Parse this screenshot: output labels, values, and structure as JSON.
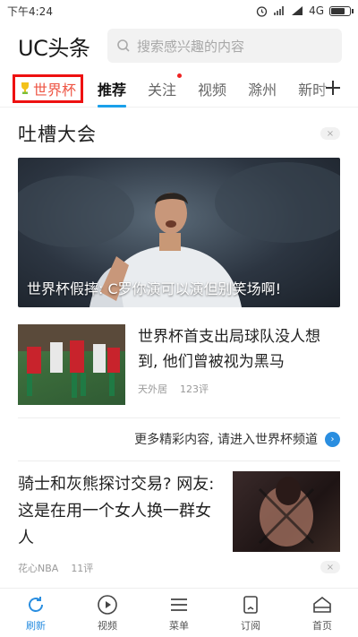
{
  "status_bar": {
    "time": "下午4:24",
    "network": "4G",
    "battery_level": 0.8
  },
  "header": {
    "logo": "UC头条",
    "search_placeholder": "搜索感兴趣的内容"
  },
  "tabs": [
    {
      "label": "世界杯"
    },
    {
      "label": "推荐"
    },
    {
      "label": "关注"
    },
    {
      "label": "视频"
    },
    {
      "label": "滁州"
    },
    {
      "label": "新时"
    }
  ],
  "section": {
    "title": "吐槽大会",
    "close_glyph": "×"
  },
  "hero": {
    "caption": "世界杯假摔: C罗你演可以演但别笑场啊!"
  },
  "news_1": {
    "title": "世界杯首支出局球队没人想到, 他们曾被视为黑马",
    "source": "天外居",
    "comments": "123评"
  },
  "more_link": {
    "label": "更多精彩内容, 请进入世界杯频道",
    "arrow": "›"
  },
  "news_2": {
    "title": "骑士和灰熊探讨交易? 网友: 这是在用一个女人换一群女人",
    "source": "花心NBA",
    "comments": "11评",
    "close_glyph": "×"
  },
  "bottom_nav": [
    {
      "label": "刷新",
      "icon": "refresh-icon"
    },
    {
      "label": "视频",
      "icon": "play-icon"
    },
    {
      "label": "菜单",
      "icon": "menu-icon"
    },
    {
      "label": "订阅",
      "icon": "subscribe-icon"
    },
    {
      "label": "首页",
      "icon": "home-icon"
    }
  ],
  "colors": {
    "accent_blue": "#2a8ee0",
    "highlight_red": "#e11111"
  }
}
